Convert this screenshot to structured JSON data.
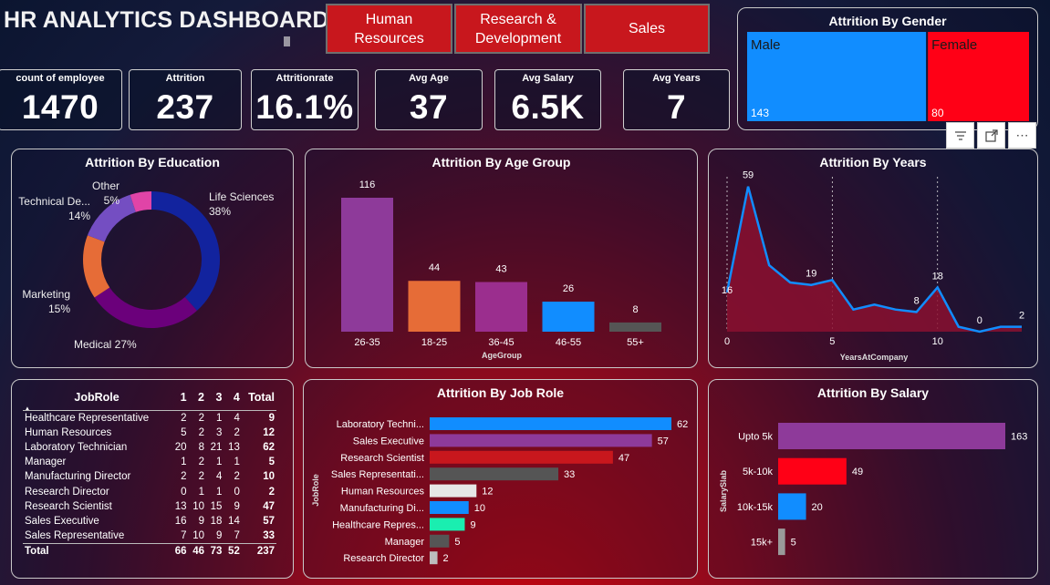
{
  "header": {
    "title": "HR ANALYTICS DASHBOARD",
    "departments": [
      "Human\nResources",
      "Research &\nDevelopment",
      "Sales"
    ]
  },
  "kpis": [
    {
      "label": "count of employee",
      "value": "1470"
    },
    {
      "label": "Attrition",
      "value": "237"
    },
    {
      "label": "Attritionrate",
      "value": "16.1%"
    },
    {
      "label": "Avg Age",
      "value": "37"
    },
    {
      "label": "Avg Salary",
      "value": "6.5K"
    },
    {
      "label": "Avg Years",
      "value": "7"
    }
  ],
  "colors": {
    "accent_red": "#c8171d",
    "blue": "#118dff",
    "red": "#ff0016",
    "navy": "#12239e",
    "purple": "#6b007b",
    "orange": "#e66c37",
    "violet": "#744ec2",
    "pink": "#e044a7",
    "magenta": "#9b2e8e",
    "gray": "#555555",
    "teal": "#1aeeb0",
    "light_gray": "#e6e6e6",
    "line_fill": "#8a1030"
  },
  "toolbar": {
    "icons": [
      "filter-icon",
      "focus-mode-icon",
      "more-options-icon"
    ]
  },
  "chart_data": [
    {
      "id": "gender",
      "type": "treemap",
      "title": "Attrition By Gender",
      "categories": [
        "Male",
        "Female"
      ],
      "values": [
        143,
        80
      ],
      "colors": [
        "#118dff",
        "#ff0016"
      ]
    },
    {
      "id": "education",
      "type": "pie",
      "title": "Attrition By Education",
      "categories": [
        "Life Sciences",
        "Medical",
        "Marketing",
        "Technical De...",
        "Other"
      ],
      "values": [
        38,
        27,
        15,
        14,
        5
      ],
      "labels": [
        "38%",
        "27%",
        "15%",
        "14%",
        "5%"
      ],
      "colors": [
        "#12239e",
        "#6b007b",
        "#e66c37",
        "#744ec2",
        "#e044a7",
        "#118dff"
      ]
    },
    {
      "id": "agegroup",
      "type": "bar",
      "title": "Attrition By Age Group",
      "xlabel": "AgeGroup",
      "categories": [
        "26-35",
        "18-25",
        "36-45",
        "46-55",
        "55+"
      ],
      "values": [
        116,
        44,
        43,
        26,
        8
      ],
      "colors": [
        "#8e3a9a",
        "#e66c37",
        "#9b2e8e",
        "#118dff",
        "#555555"
      ]
    },
    {
      "id": "years",
      "type": "area",
      "title": "Attrition By Years",
      "xlabel": "YearsAtCompany",
      "x": [
        0,
        1,
        2,
        3,
        4,
        5,
        6,
        7,
        8,
        9,
        10,
        11,
        12,
        13,
        14
      ],
      "values": [
        16,
        59,
        27,
        20,
        19,
        21,
        9,
        11,
        9,
        8,
        18,
        2,
        0,
        2,
        2
      ],
      "value_labels": [
        {
          "x": 0,
          "label": "16"
        },
        {
          "x": 1,
          "label": "59"
        },
        {
          "x": 4,
          "label": "19"
        },
        {
          "x": 9,
          "label": "8"
        },
        {
          "x": 10,
          "label": "18"
        },
        {
          "x": 12,
          "label": "0"
        },
        {
          "x": 14,
          "label": "2"
        }
      ],
      "xticks": [
        0,
        5,
        10
      ],
      "xlim": [
        0,
        14
      ],
      "ylim": [
        0,
        60
      ]
    },
    {
      "id": "jobrole",
      "type": "bar",
      "orientation": "horizontal",
      "title": "Attrition By Job Role",
      "ylabel": "JobRole",
      "categories": [
        "Laboratory Techni...",
        "Sales Executive",
        "Research Scientist",
        "Sales Representati...",
        "Human Resources",
        "Manufacturing Di...",
        "Healthcare Repres...",
        "Manager",
        "Research Director"
      ],
      "values": [
        62,
        57,
        47,
        33,
        12,
        10,
        9,
        5,
        2
      ],
      "colors": [
        "#118dff",
        "#8e3a9a",
        "#c8171d",
        "#555555",
        "#e6e6e6",
        "#118dff",
        "#1aeeb0",
        "#555555",
        "#bdbdbd"
      ],
      "xlim": [
        0,
        62
      ]
    },
    {
      "id": "salary",
      "type": "bar",
      "orientation": "horizontal",
      "title": "Attrition By Salary",
      "ylabel": "SalarySlab",
      "categories": [
        "Upto 5k",
        "5k-10k",
        "10k-15k",
        "15k+"
      ],
      "values": [
        163,
        49,
        20,
        5
      ],
      "colors": [
        "#8e3a9a",
        "#ff0016",
        "#118dff",
        "#9a9a9a"
      ],
      "xlim": [
        0,
        163
      ]
    },
    {
      "id": "jobrole_table",
      "type": "table",
      "columns": [
        "JobRole",
        "1",
        "2",
        "3",
        "4",
        "Total"
      ],
      "rows": [
        [
          "Healthcare Representative",
          "2",
          "2",
          "1",
          "4",
          "9"
        ],
        [
          "Human Resources",
          "5",
          "2",
          "3",
          "2",
          "12"
        ],
        [
          "Laboratory Technician",
          "20",
          "8",
          "21",
          "13",
          "62"
        ],
        [
          "Manager",
          "1",
          "2",
          "1",
          "1",
          "5"
        ],
        [
          "Manufacturing Director",
          "2",
          "2",
          "4",
          "2",
          "10"
        ],
        [
          "Research Director",
          "0",
          "1",
          "1",
          "0",
          "2"
        ],
        [
          "Research Scientist",
          "13",
          "10",
          "15",
          "9",
          "47"
        ],
        [
          "Sales Executive",
          "16",
          "9",
          "18",
          "14",
          "57"
        ],
        [
          "Sales Representative",
          "7",
          "10",
          "9",
          "7",
          "33"
        ]
      ],
      "total": [
        "Total",
        "66",
        "46",
        "73",
        "52",
        "237"
      ]
    }
  ]
}
